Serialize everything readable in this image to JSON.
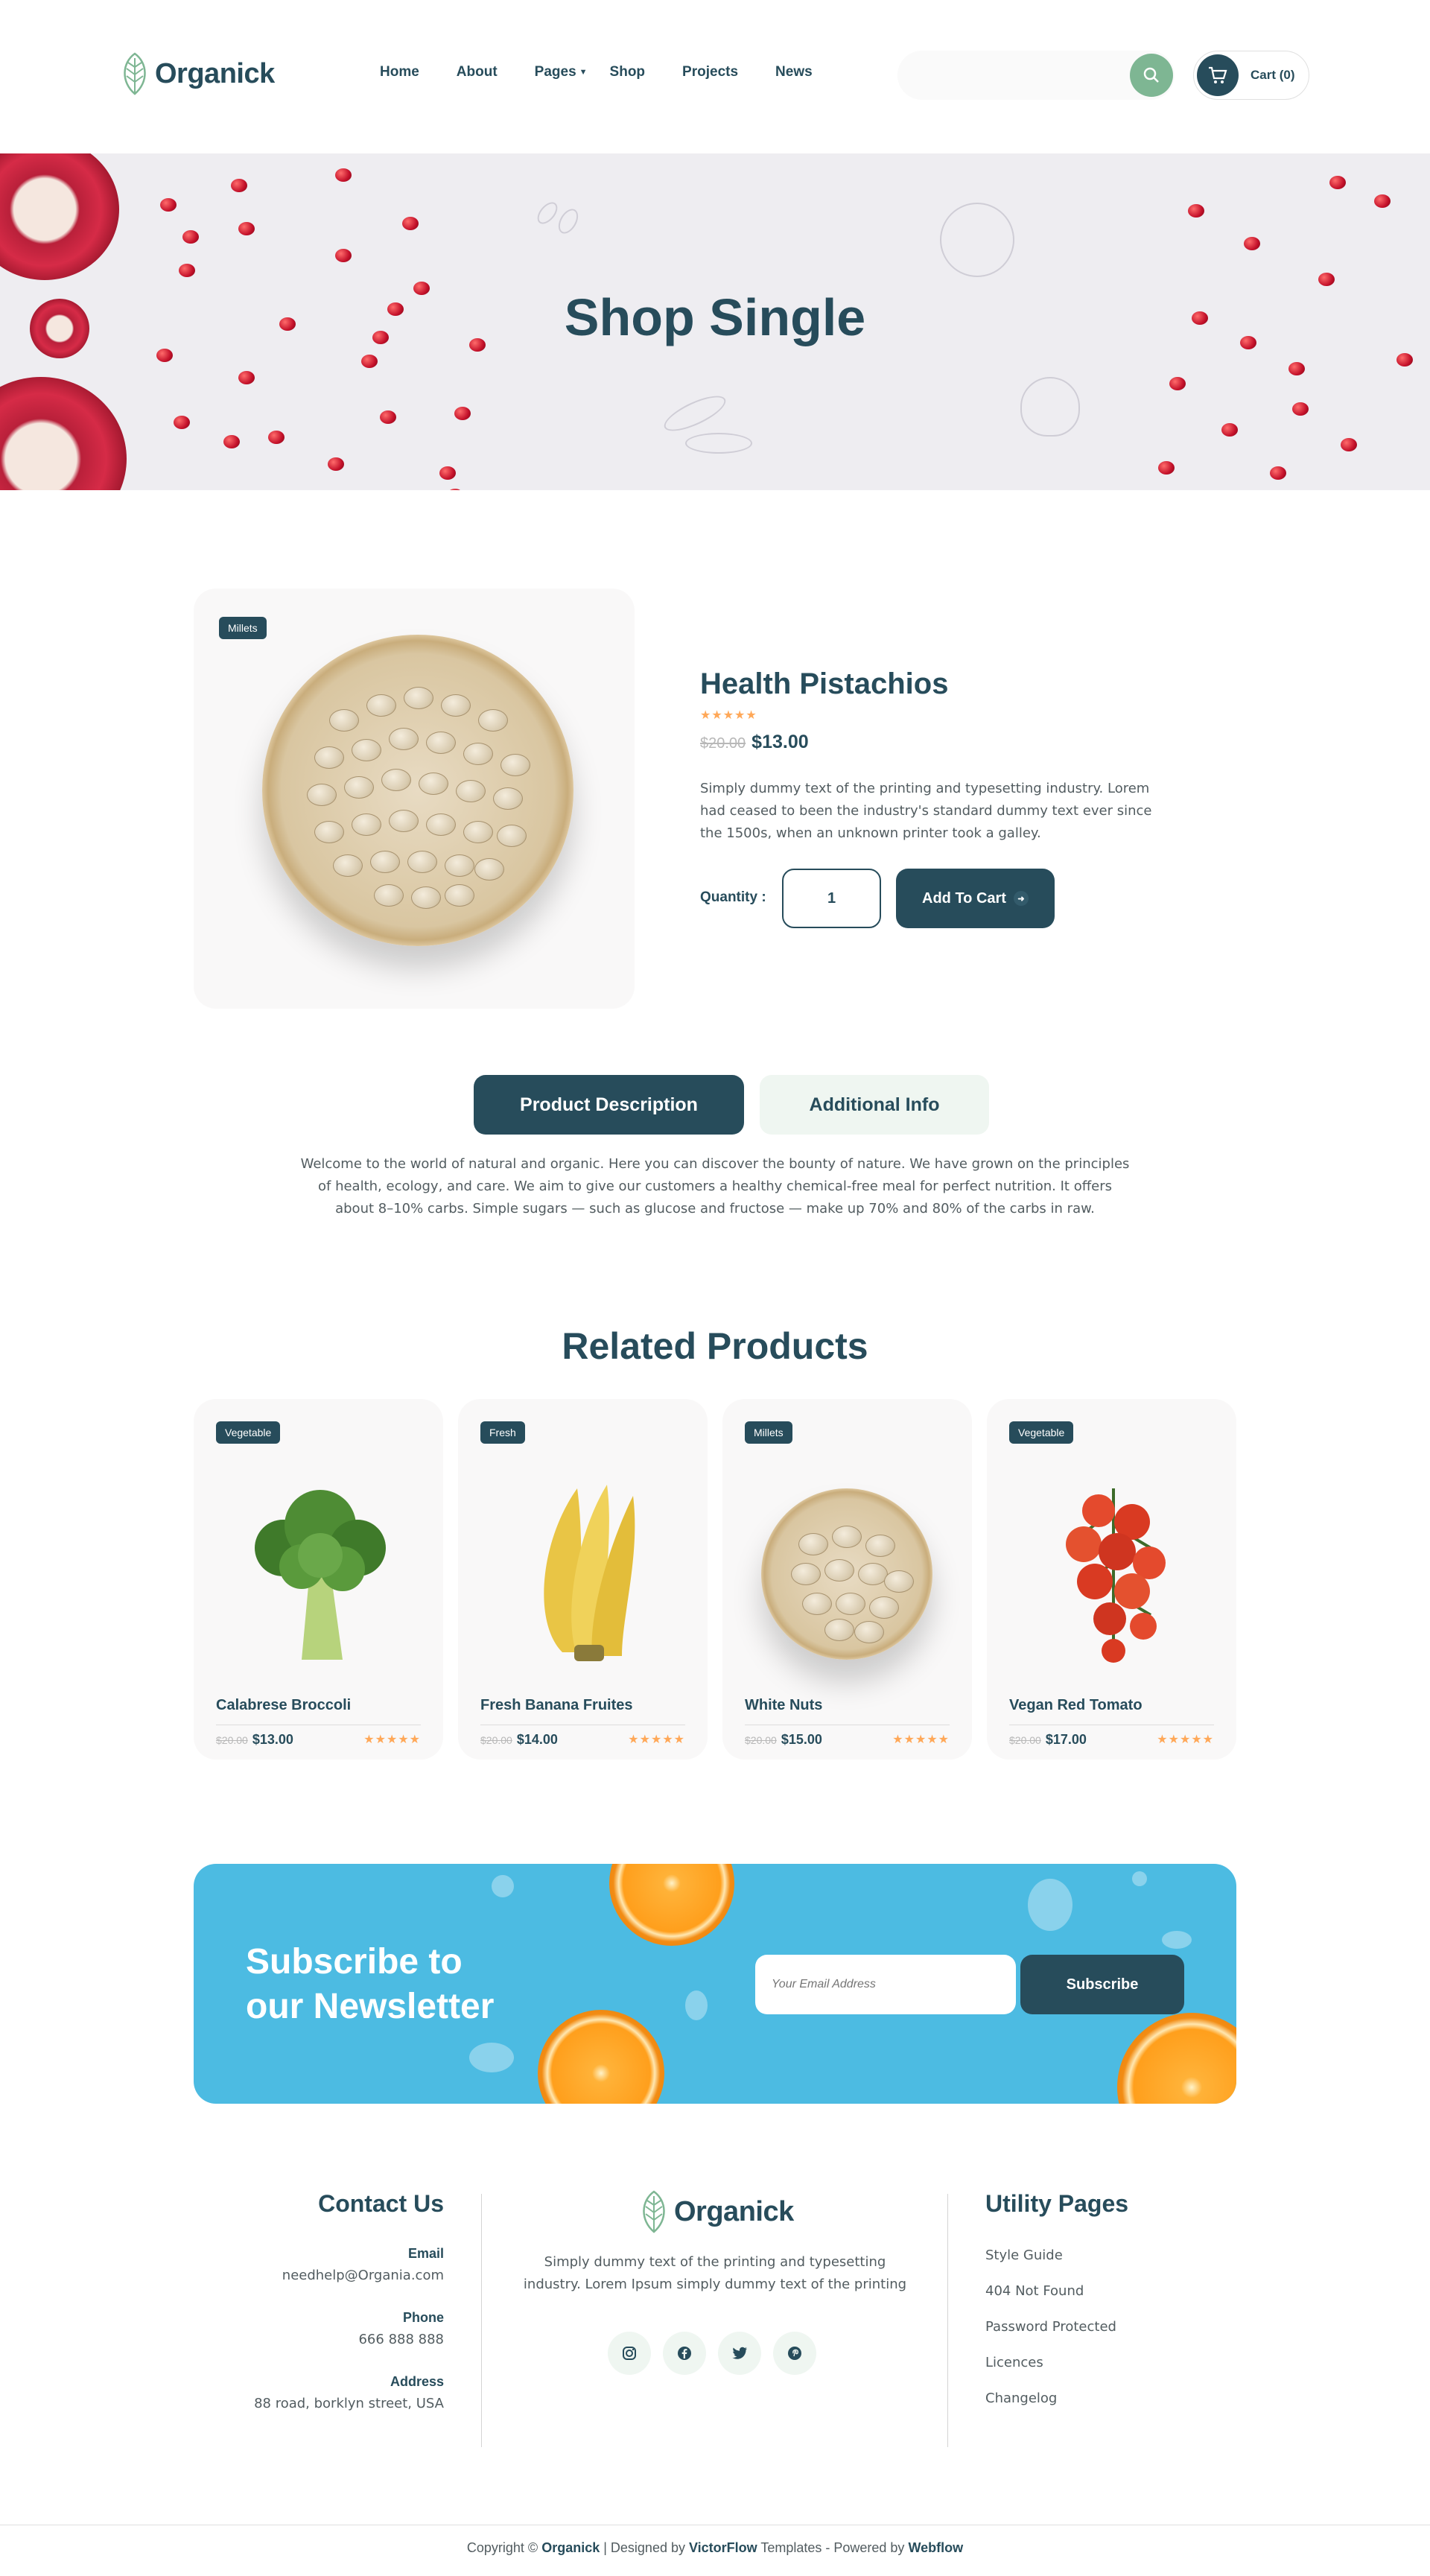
{
  "header": {
    "brand": "Organick",
    "nav": [
      "Home",
      "About",
      "Pages",
      "Shop",
      "Projects",
      "News"
    ],
    "cart_label": "Cart (0)"
  },
  "hero": {
    "title": "Shop Single"
  },
  "product": {
    "badge": "Millets",
    "title": "Health Pistachios",
    "rating": "★★★★★",
    "price_old": "$20.00",
    "price": "$13.00",
    "description": "Simply dummy text of the printing and typesetting industry. Lorem had ceased to been the industry's standard dummy text ever since the 1500s, when an unknown printer took a galley.",
    "quantity_label": "Quantity :",
    "quantity": "1",
    "add_to_cart": "Add To Cart"
  },
  "tabs": {
    "active": "Product Description",
    "inactive": "Additional Info",
    "body": "Welcome to the world of natural and organic. Here you can discover the bounty of nature. We have grown on the principles of health, ecology, and care. We aim to give our customers a healthy chemical-free meal for perfect nutrition. It offers about 8–10% carbs. Simple sugars — such as glucose and fructose — make up 70% and 80% of the carbs in raw."
  },
  "related": {
    "title": "Related Products",
    "items": [
      {
        "badge": "Vegetable",
        "name": "Calabrese Broccoli",
        "price_old": "$20.00",
        "price": "$13.00",
        "rating": "★★★★★"
      },
      {
        "badge": "Fresh",
        "name": "Fresh Banana Fruites",
        "price_old": "$20.00",
        "price": "$14.00",
        "rating": "★★★★★"
      },
      {
        "badge": "Millets",
        "name": "White Nuts",
        "price_old": "$20.00",
        "price": "$15.00",
        "rating": "★★★★★"
      },
      {
        "badge": "Vegetable",
        "name": "Vegan Red Tomato",
        "price_old": "$20.00",
        "price": "$17.00",
        "rating": "★★★★★"
      }
    ]
  },
  "newsletter": {
    "title_line1": "Subscribe to",
    "title_line2": "our Newsletter",
    "placeholder": "Your Email Address",
    "button": "Subscribe"
  },
  "footer": {
    "contact_title": "Contact Us",
    "email_label": "Email",
    "email": "needhelp@Organia.com",
    "phone_label": "Phone",
    "phone": "666 888 888",
    "address_label": "Address",
    "address": "88 road, borklyn street, USA",
    "brand": "Organick",
    "about": "Simply dummy text of the printing and typesetting industry. Lorem Ipsum simply dummy text of the printing",
    "utility_title": "Utility Pages",
    "utility_links": [
      "Style Guide",
      "404 Not Found",
      "Password Protected",
      "Licences",
      "Changelog"
    ],
    "copy_prefix": "Copyright © ",
    "copy_brand": "Organick",
    "copy_mid": " | Designed by ",
    "copy_designer": "VictorFlow",
    "copy_mid2": " Templates - Powered by ",
    "copy_platform": "Webflow"
  },
  "colors": {
    "primary": "#274c5b",
    "accent_green": "#7eb693",
    "star": "#ffa858",
    "newsletter_bg": "#4cbbe2"
  },
  "icons": [
    "leaf-logo-icon",
    "chevron-down-icon",
    "search-icon",
    "cart-icon",
    "arrow-right-icon",
    "instagram-icon",
    "facebook-icon",
    "twitter-icon",
    "pinterest-icon"
  ]
}
